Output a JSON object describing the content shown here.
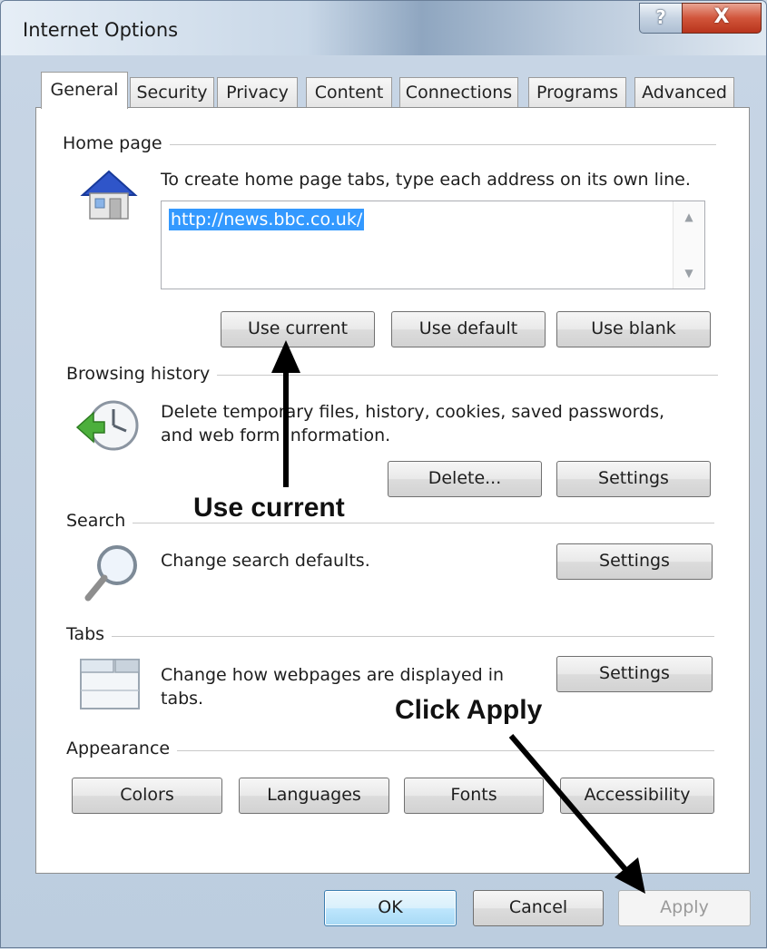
{
  "window": {
    "title": "Internet Options",
    "help_label": "?",
    "close_label": "X"
  },
  "tabs": [
    {
      "label": "General",
      "active": true
    },
    {
      "label": "Security"
    },
    {
      "label": "Privacy"
    },
    {
      "label": "Content"
    },
    {
      "label": "Connections"
    },
    {
      "label": "Programs"
    },
    {
      "label": "Advanced"
    }
  ],
  "home_page": {
    "section_label": "Home page",
    "description": "To create home page tabs, type each address on its own line.",
    "value": "http://news.bbc.co.uk/",
    "buttons": {
      "use_current": "Use current",
      "use_default": "Use default",
      "use_blank": "Use blank"
    }
  },
  "browsing_history": {
    "section_label": "Browsing history",
    "description_line1": "Delete temporary files, history, cookies, saved passwords,",
    "description_line2": "and web form information.",
    "buttons": {
      "delete": "Delete...",
      "settings": "Settings"
    }
  },
  "search": {
    "section_label": "Search",
    "description": "Change search defaults.",
    "settings": "Settings"
  },
  "tabs_section": {
    "section_label": "Tabs",
    "description_line1": "Change how webpages are displayed in",
    "description_line2": "tabs.",
    "settings": "Settings"
  },
  "appearance": {
    "section_label": "Appearance",
    "buttons": {
      "colors": "Colors",
      "languages": "Languages",
      "fonts": "Fonts",
      "accessibility": "Accessibility"
    }
  },
  "footer": {
    "ok": "OK",
    "cancel": "Cancel",
    "apply": "Apply",
    "apply_enabled": false
  },
  "annotations": {
    "use_current": "Use current",
    "click_apply": "Click Apply"
  },
  "icons": {
    "home_page": "house-icon",
    "browsing_history": "history-clock-icon",
    "search": "magnifier-icon",
    "tabs": "tabs-window-icon",
    "arrows": "arrow-icon"
  },
  "colors": {
    "selection": "#3399ff",
    "close_button": "#c9462c",
    "ok_button_border": "#3c7fb1"
  }
}
